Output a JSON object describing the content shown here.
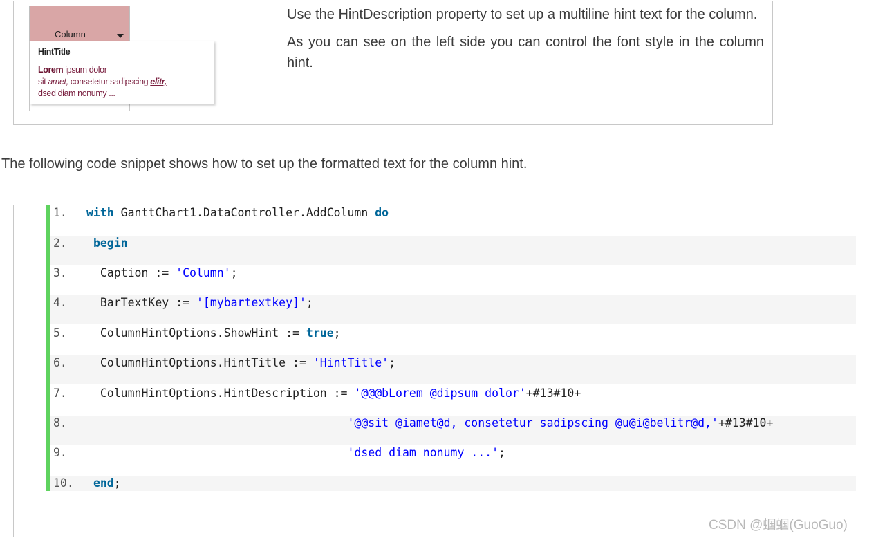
{
  "hint_demo": {
    "column_caption": "Column",
    "hint_title": "HintTitle",
    "hint_lines": [
      {
        "bold": "Lorem",
        "normal": " ipsum dolor"
      },
      {
        "pre": "sit ",
        "italic": "amet,",
        "mid": " consetetur sadipscing ",
        "emph": "elitr,"
      },
      {
        "text": "dsed diam nonumy ..."
      }
    ]
  },
  "description": {
    "paragraph1": "Use the HintDescription property to set up a multiline hint text for the column.",
    "paragraph2": "As you can see on the left side you can control the font style in the column hint."
  },
  "intro_text": "The following code snippet shows how to set up the formatted text for the column hint.",
  "code": {
    "line_numbers": [
      "1.",
      "2.",
      "3.",
      "4.",
      "5.",
      "6.",
      "7.",
      "8.",
      "9.",
      "10."
    ],
    "lines": [
      {
        "kw1": "with",
        "t1": " GanttChart1.DataController.AddColumn ",
        "kw2": "do"
      },
      {
        "indent": " ",
        "kw1": "begin"
      },
      {
        "t1": "  Caption := ",
        "str": "'Column'",
        "t2": ";"
      },
      {
        "t1": "  BarTextKey := ",
        "str": "'[mybartextkey]'",
        "t2": ";"
      },
      {
        "t1": "  ColumnHintOptions.ShowHint := ",
        "kw1": "true",
        "t2": ";"
      },
      {
        "t1": "  ColumnHintOptions.HintTitle := ",
        "str": "'HintTitle'",
        "t2": ";"
      },
      {
        "t1": "  ColumnHintOptions.HintDescription := ",
        "str": "'@@@bLorem @dipsum dolor'",
        "t2": "+#13#10+"
      },
      {
        "t1": "                                      ",
        "str": "'@@sit @iamet@d, consetetur sadipscing @u@i@belitr@d,'",
        "t2": "+#13#10+"
      },
      {
        "t1": "                                      ",
        "str": "'dsed diam nonumy ...'",
        "t2": ";"
      },
      {
        "indent": " ",
        "kw1": "end",
        "t2": ";"
      }
    ]
  },
  "watermark": "CSDN @蝈蝈(GuoGuo)",
  "colors": {
    "header_fill": "#d9a6a6",
    "code_bar": "#5fd35f",
    "keyword": "#006699",
    "string": "#0000ff"
  }
}
